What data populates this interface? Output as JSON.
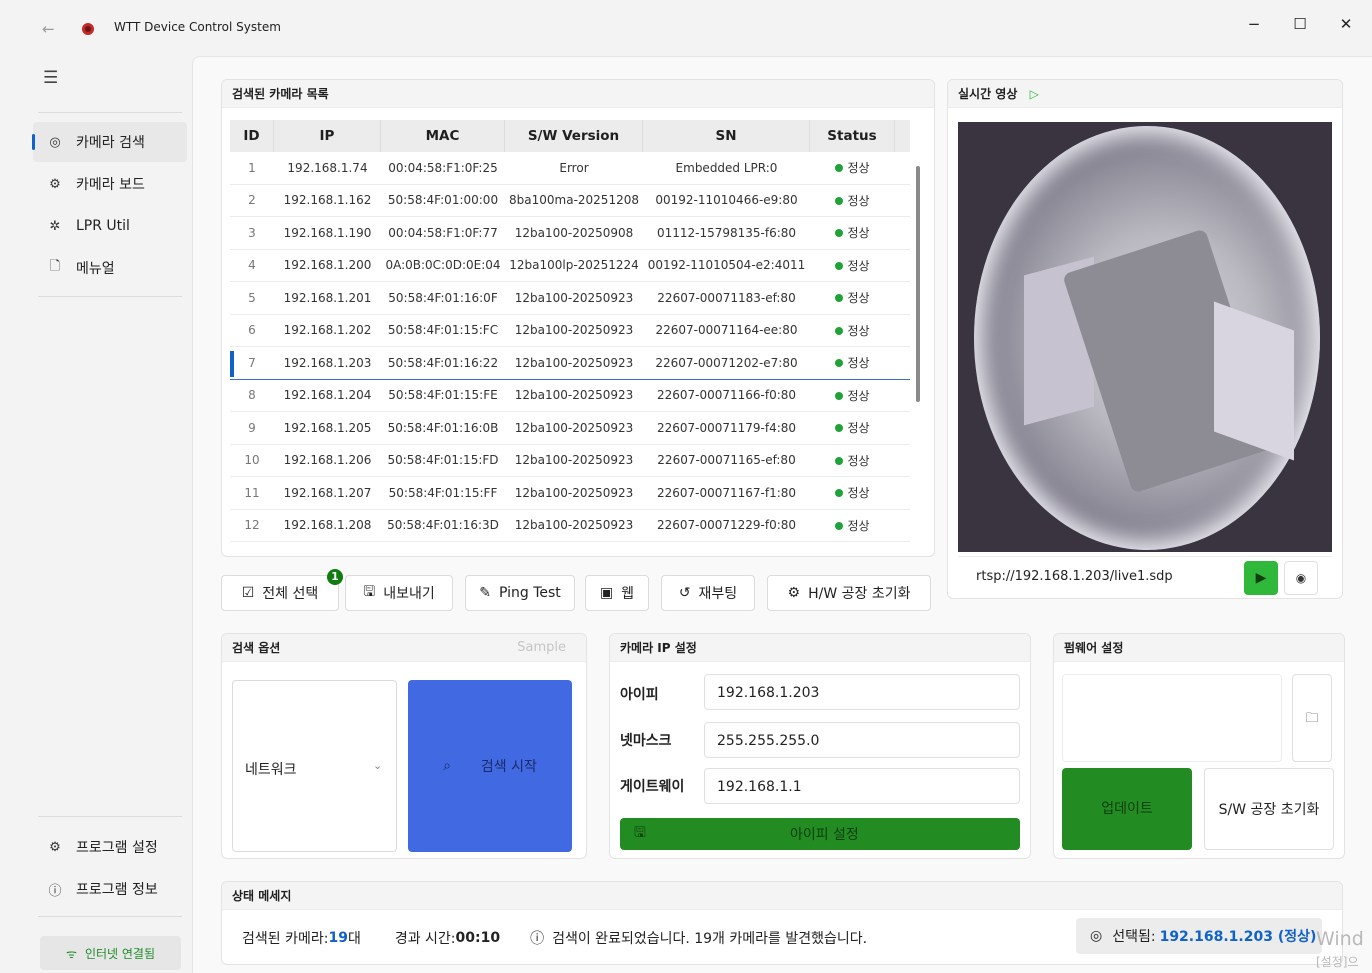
{
  "window": {
    "title": "WTT Device Control System",
    "back_icon": "←",
    "minimize": "−",
    "maximize": "☐",
    "close": "✕"
  },
  "sidebar": {
    "items": [
      {
        "label": "카메라 검색",
        "icon": "camera-icon",
        "glyph": "◎"
      },
      {
        "label": "카메라 보드",
        "icon": "gear-icon",
        "glyph": "⚙"
      },
      {
        "label": "LPR Util",
        "icon": "fan-icon",
        "glyph": "✲"
      },
      {
        "label": "메뉴얼",
        "icon": "document-icon",
        "glyph": "🗋"
      }
    ],
    "bottom": [
      {
        "label": "프로그램 설정",
        "icon": "gear-icon",
        "glyph": "⚙"
      },
      {
        "label": "프로그램 정보",
        "icon": "info-icon",
        "glyph": "ⓘ"
      }
    ],
    "network_status": "인터넷 연결됨"
  },
  "camera_list": {
    "title": "검색된 카메라 목록",
    "columns": [
      "ID",
      "IP",
      "MAC",
      "S/W Version",
      "SN",
      "Status"
    ],
    "rows": [
      [
        "1",
        "192.168.1.74",
        "00:04:58:F1:0F:25",
        "Error",
        "Embedded LPR:0",
        "정상"
      ],
      [
        "2",
        "192.168.1.162",
        "50:58:4F:01:00:00",
        "8ba100ma-20251208",
        "00192-11010466-e9:80",
        "정상"
      ],
      [
        "3",
        "192.168.1.190",
        "00:04:58:F1:0F:77",
        "12ba100-20250908",
        "01112-15798135-f6:80",
        "정상"
      ],
      [
        "4",
        "192.168.1.200",
        "0A:0B:0C:0D:0E:04",
        "12ba100lp-20251224",
        "00192-11010504-e2:4011",
        "정상"
      ],
      [
        "5",
        "192.168.1.201",
        "50:58:4F:01:16:0F",
        "12ba100-20250923",
        "22607-00071183-ef:80",
        "정상"
      ],
      [
        "6",
        "192.168.1.202",
        "50:58:4F:01:15:FC",
        "12ba100-20250923",
        "22607-00071164-ee:80",
        "정상"
      ],
      [
        "7",
        "192.168.1.203",
        "50:58:4F:01:16:22",
        "12ba100-20250923",
        "22607-00071202-e7:80",
        "정상"
      ],
      [
        "8",
        "192.168.1.204",
        "50:58:4F:01:15:FE",
        "12ba100-20250923",
        "22607-00071166-f0:80",
        "정상"
      ],
      [
        "9",
        "192.168.1.205",
        "50:58:4F:01:16:0B",
        "12ba100-20250923",
        "22607-00071179-f4:80",
        "정상"
      ],
      [
        "10",
        "192.168.1.206",
        "50:58:4F:01:15:FD",
        "12ba100-20250923",
        "22607-00071165-ef:80",
        "정상"
      ],
      [
        "11",
        "192.168.1.207",
        "50:58:4F:01:15:FF",
        "12ba100-20250923",
        "22607-00071167-f1:80",
        "정상"
      ],
      [
        "12",
        "192.168.1.208",
        "50:58:4F:01:16:3D",
        "12ba100-20250923",
        "22607-00071229-f0:80",
        "정상"
      ]
    ],
    "selected_id": "7"
  },
  "actions": {
    "select_all": "전체 선택",
    "select_all_badge": "1",
    "export": "내보내기",
    "ping": "Ping Test",
    "web": "웹",
    "reboot": "재부팅",
    "hw_reset": "H/W 공장 초기화"
  },
  "live_video": {
    "title": "실시간 영상",
    "play_glyph": "▷",
    "url": "rtsp://192.168.1.203/live1.sdp"
  },
  "search_options": {
    "title": "검색 옵션",
    "sample": "Sample",
    "network_select": "네트워크",
    "start_button": "검색 시작"
  },
  "ip_settings": {
    "title": "카메라 IP 설정",
    "ip_label": "아이피",
    "ip_value": "192.168.1.203",
    "netmask_label": "넷마스크",
    "netmask_value": "255.255.255.0",
    "gateway_label": "게이트웨이",
    "gateway_value": "192.168.1.1",
    "set_button": "아이피 설정"
  },
  "firmware": {
    "title": "펌웨어 설정",
    "update_button": "업데이트",
    "sw_reset_button": "S/W 공장 초기화"
  },
  "status_message": {
    "title": "상태 메세지",
    "found_label": "검색된 카메라:",
    "found_count": "19",
    "found_unit": " 대",
    "elapsed_label": "경과 시간:",
    "elapsed_value": "00:10",
    "message": "검색이 완료되었습니다. 19개 카메라를 발견했습니다.",
    "selected_label": "선택됨:",
    "selected_value": "192.168.1.203 (정상)"
  },
  "watermark": {
    "line1": "Wind",
    "line2": "[설정]으"
  },
  "colors": {
    "accent": "#0f62c7",
    "ok_green": "#1fa23a",
    "button_green": "#228b22",
    "search_blue": "#4169e1"
  }
}
